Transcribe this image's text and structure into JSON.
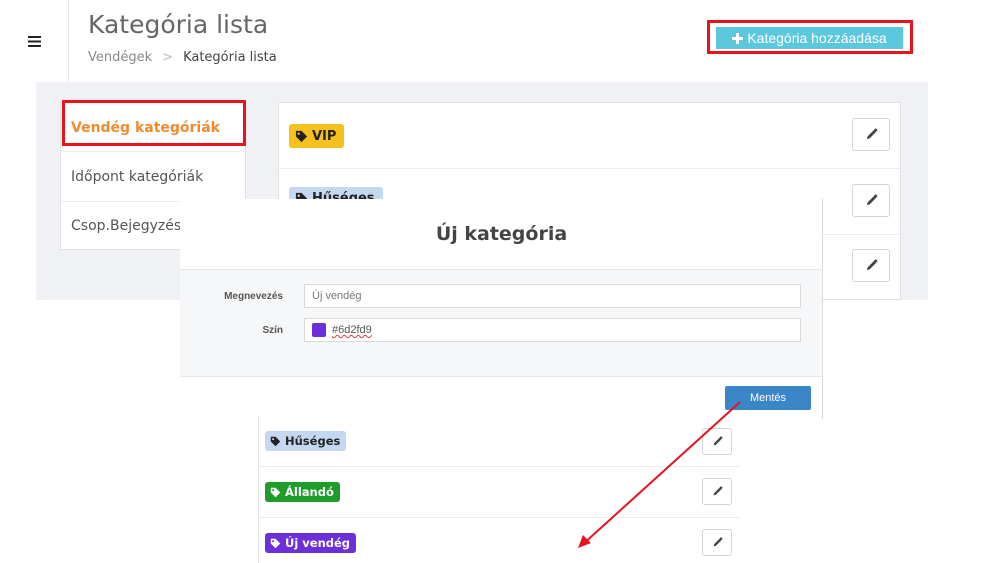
{
  "header": {
    "title": "Kategória lista",
    "breadcrumb": {
      "parent": "Vendégek",
      "separator": ">",
      "current": "Kategória lista"
    },
    "add_button_label": "Kategória hozzáadása",
    "menu_icon": "hamburger-icon"
  },
  "sidebar": {
    "items": [
      {
        "label": "Vendég kategóriák",
        "active": true
      },
      {
        "label": "Időpont kategóriák",
        "active": false
      },
      {
        "label": "Csop.Bejegyzés ka",
        "active": false
      }
    ]
  },
  "categories": [
    {
      "label": "VIP",
      "color": "#f6c11c",
      "text_color": "#222222"
    },
    {
      "label": "Hűséges",
      "color": "#c4d8f2",
      "text_color": "#222222"
    },
    {
      "label": "",
      "color": "#ffffff",
      "text_color": "#222222"
    }
  ],
  "modal": {
    "title": "Új kategória",
    "name_label": "Megnevezés",
    "name_value": "Új vendég",
    "color_label": "Szín",
    "color_value": "#6d2fd9",
    "save_label": "Mentés"
  },
  "result_list": [
    {
      "label": "Hűséges",
      "color": "#c4d8f2",
      "text_color": "#222222"
    },
    {
      "label": "Állandó",
      "color": "#1f9d2b",
      "text_color": "#ffffff"
    },
    {
      "label": "Új vendég",
      "color": "#6d2fd9",
      "text_color": "#ffffff"
    }
  ],
  "colors": {
    "accent_orange": "#f28a30",
    "highlight_red": "#e8131f",
    "add_button": "#5bc8de",
    "save_button": "#3a86c8",
    "annotation_arrow": "#e8131f"
  },
  "icons": {
    "tag": "tag-icon",
    "edit": "pencil-icon",
    "add": "plus-icon"
  }
}
